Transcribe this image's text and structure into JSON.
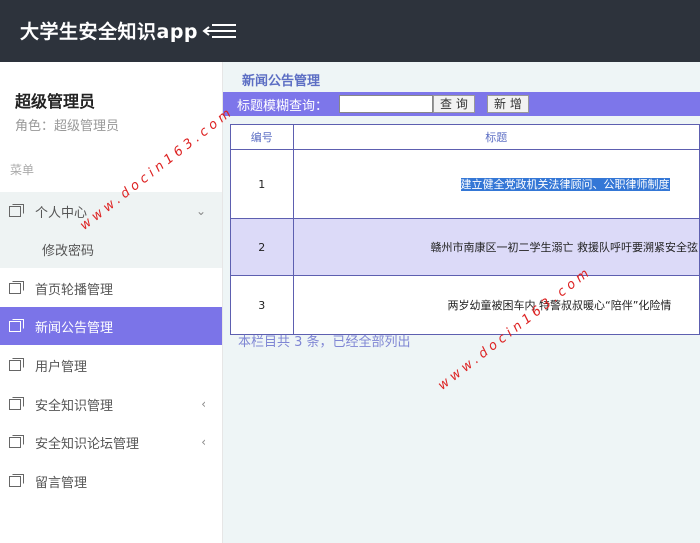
{
  "header": {
    "app_title": "大学生安全知识app"
  },
  "user": {
    "name": "超级管理员",
    "role": "角色：超级管理员"
  },
  "sidebar": {
    "menu_heading": "菜单",
    "items": [
      {
        "label": "个人中心"
      },
      {
        "label": "修改密码"
      },
      {
        "label": "首页轮播管理"
      },
      {
        "label": "新闻公告管理"
      },
      {
        "label": "用户管理"
      },
      {
        "label": "安全知识管理"
      },
      {
        "label": "安全知识论坛管理"
      },
      {
        "label": "留言管理"
      }
    ],
    "active": "新闻公告管理"
  },
  "main": {
    "page_title": "新闻公告管理",
    "search": {
      "label": "标题模糊查询：",
      "value": "",
      "query_button": "查 询",
      "add_button": "新 增"
    },
    "table": {
      "columns": [
        "编号",
        "标题"
      ],
      "rows": [
        {
          "id": "1",
          "title": "建立健全党政机关法律顾问、公职律师制度"
        },
        {
          "id": "2",
          "title": "赣州市南康区一初二学生溺亡 救援队呼吁要溯紧安全弦"
        },
        {
          "id": "3",
          "title": "两岁幼童被困车内 特警叔叔暖心“陪伴”化险情"
        }
      ]
    },
    "summary": "本栏目共 3 条，已经全部列出"
  },
  "watermark": "www.docin163.com",
  "colors": {
    "topbar": "#2d333c",
    "accent": "#7b74e8",
    "search_bar": "#7d76ea",
    "content_bg": "#eef5f6"
  }
}
